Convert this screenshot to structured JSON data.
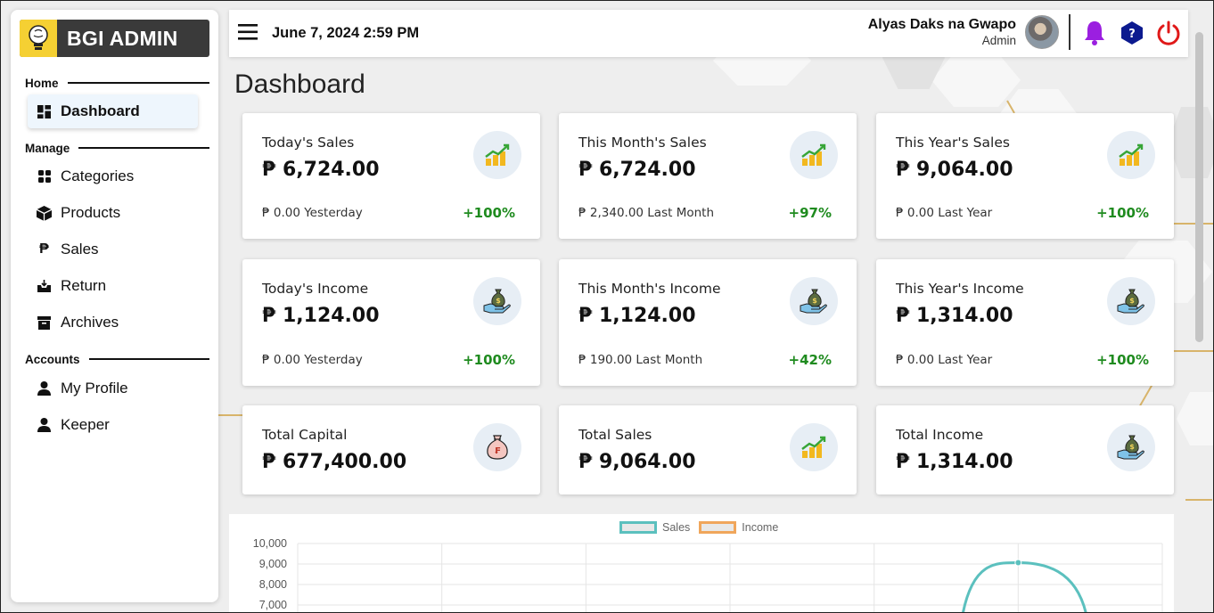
{
  "app": {
    "brand_title": "BGI ADMIN"
  },
  "sidebar": {
    "sections": [
      {
        "label": "Home"
      },
      {
        "label": "Manage"
      },
      {
        "label": "Accounts"
      }
    ],
    "items": [
      {
        "label": "Dashboard",
        "icon": "dashboard-icon",
        "active": true
      },
      {
        "label": "Categories",
        "icon": "grid-icon"
      },
      {
        "label": "Products",
        "icon": "box-icon"
      },
      {
        "label": "Sales",
        "icon": "peso-icon"
      },
      {
        "label": "Return",
        "icon": "inbox-download-icon"
      },
      {
        "label": "Archives",
        "icon": "archive-icon"
      },
      {
        "label": "My Profile",
        "icon": "user-icon"
      },
      {
        "label": "Keeper",
        "icon": "user-icon"
      }
    ]
  },
  "topbar": {
    "datetime": "June 7, 2024 2:59 PM",
    "user_name": "Alyas Daks na Gwapo",
    "user_role": "Admin",
    "icons": [
      "menu-icon",
      "bell-icon",
      "help-icon",
      "power-icon"
    ]
  },
  "main": {
    "page_title": "Dashboard",
    "cards": [
      {
        "label": "Today's Sales",
        "value": "₱ 6,724.00",
        "sub": "₱ 0.00 Yesterday",
        "pct": "+100%",
        "icon": "sales-growth-icon"
      },
      {
        "label": "This Month's Sales",
        "value": "₱ 6,724.00",
        "sub": "₱ 2,340.00 Last Month",
        "pct": "+97%",
        "icon": "sales-growth-icon"
      },
      {
        "label": "This Year's Sales",
        "value": "₱ 9,064.00",
        "sub": "₱ 0.00 Last Year",
        "pct": "+100%",
        "icon": "sales-growth-icon"
      },
      {
        "label": "Today's Income",
        "value": "₱ 1,124.00",
        "sub": "₱ 0.00 Yesterday",
        "pct": "+100%",
        "icon": "money-bag-hand-icon"
      },
      {
        "label": "This Month's Income",
        "value": "₱ 1,124.00",
        "sub": "₱ 190.00 Last Month",
        "pct": "+42%",
        "icon": "money-bag-hand-icon"
      },
      {
        "label": "This Year's Income",
        "value": "₱ 1,314.00",
        "sub": "₱ 0.00 Last Year",
        "pct": "+100%",
        "icon": "money-bag-hand-icon"
      },
      {
        "label": "Total Capital",
        "value": "₱ 677,400.00",
        "icon": "capital-bag-icon"
      },
      {
        "label": "Total Sales",
        "value": "₱ 9,064.00",
        "icon": "sales-growth-icon"
      },
      {
        "label": "Total Income",
        "value": "₱ 1,314.00",
        "icon": "money-bag-hand-icon"
      }
    ],
    "pct_color": "#1f8b1f"
  },
  "chart_data": {
    "type": "line",
    "legend": [
      {
        "name": "Sales",
        "color": "#5bc0be"
      },
      {
        "name": "Income",
        "color": "#f0a65b"
      }
    ],
    "y_ticks": [
      "10,000",
      "9,000",
      "8,000",
      "7,000"
    ],
    "ylim": [
      7000,
      10000
    ],
    "grid": true,
    "legend_position": "top-center",
    "series": [
      {
        "name": "Sales",
        "visible_peak": 9064
      }
    ]
  }
}
